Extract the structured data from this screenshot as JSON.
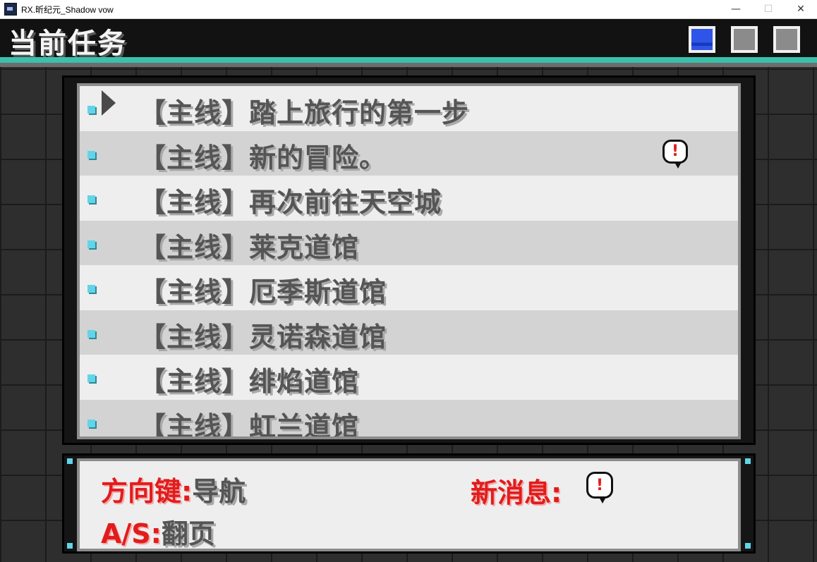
{
  "window": {
    "title": "RX.昕纪元_Shadow vow",
    "minimize_glyph": "—",
    "maximize_glyph": "☐",
    "close_glyph": "✕"
  },
  "header": {
    "title": "当前任务",
    "page_count": 3,
    "active_page": 1
  },
  "quests": [
    {
      "label": "【主线】踏上旅行的第一步",
      "selected": true,
      "has_alert": false
    },
    {
      "label": "【主线】新的冒险。",
      "selected": false,
      "has_alert": true,
      "alert_glyph": "!"
    },
    {
      "label": "【主线】再次前往天空城",
      "selected": false,
      "has_alert": false
    },
    {
      "label": "【主线】莱克道馆",
      "selected": false,
      "has_alert": false
    },
    {
      "label": "【主线】厄季斯道馆",
      "selected": false,
      "has_alert": false
    },
    {
      "label": "【主线】灵诺森道馆",
      "selected": false,
      "has_alert": false
    },
    {
      "label": "【主线】绯焰道馆",
      "selected": false,
      "has_alert": false
    },
    {
      "label": "【主线】虹兰道馆",
      "selected": false,
      "has_alert": false
    }
  ],
  "help": {
    "nav_key": "方向键:",
    "nav_desc": "导航",
    "new_msg_label": "新消息:",
    "new_msg_glyph": "!",
    "page_key": "A/S:",
    "page_desc": "翻页"
  },
  "colors": {
    "accent_teal": "#3ac0ad",
    "key_red": "#e21c1c",
    "bullet_cyan": "#62d4e8",
    "active_page_blue": "#2e55e8"
  }
}
